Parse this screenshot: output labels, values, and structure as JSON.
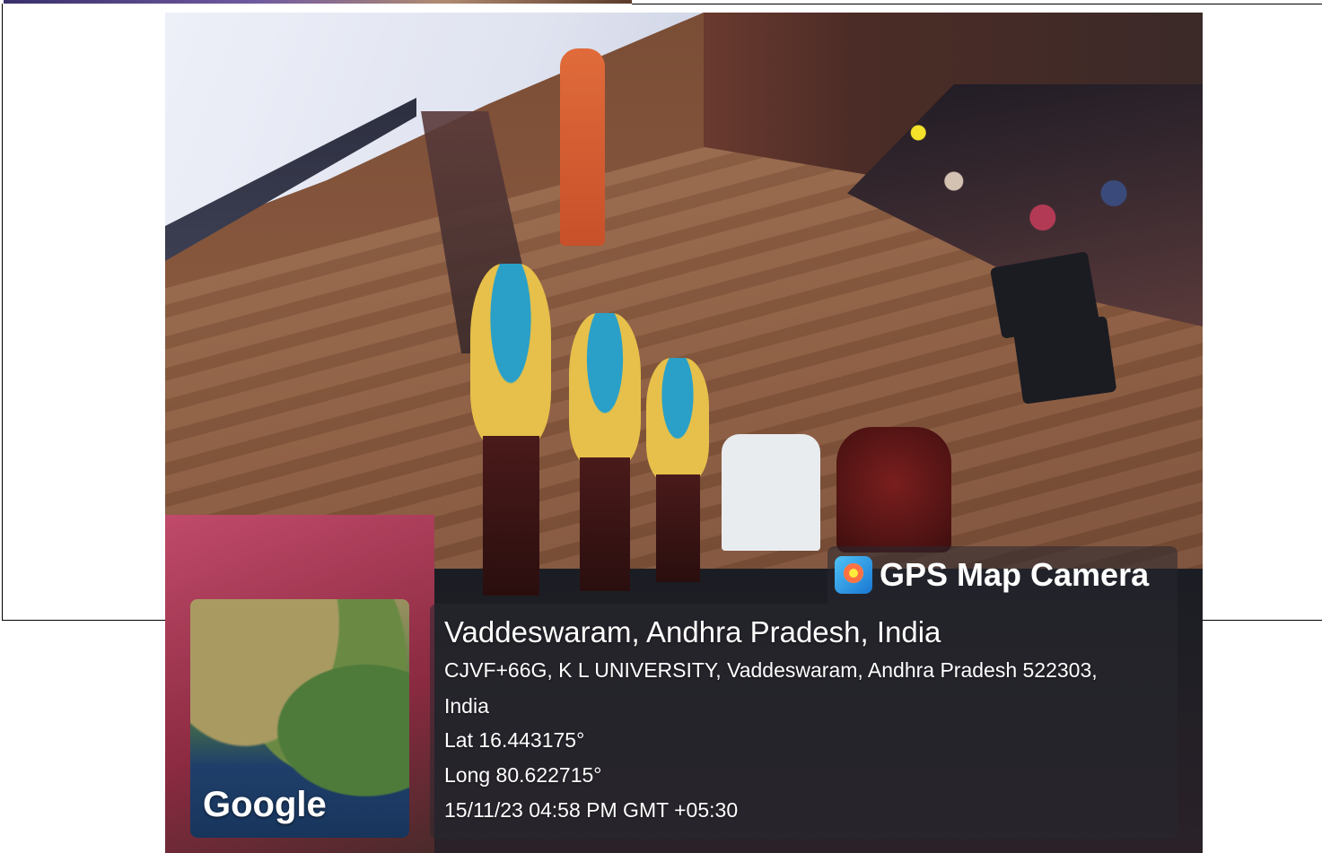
{
  "overlay": {
    "app_title": "GPS Map Camera",
    "place": "Vaddeswaram, Andhra Pradesh, India",
    "address_line1": "CJVF+66G, K L UNIVERSITY, Vaddeswaram, Andhra Pradesh 522303,",
    "address_line2": "India",
    "latitude": "Lat 16.443175°",
    "longitude": "Long 80.622715°",
    "datetime": "15/11/23 04:58 PM GMT +05:30",
    "map_brand": "Google"
  },
  "colors": {
    "overlay_bg": "#282830",
    "text": "#ffffff"
  },
  "icons": {
    "app_logo": "gps-map-camera-logo-icon"
  }
}
